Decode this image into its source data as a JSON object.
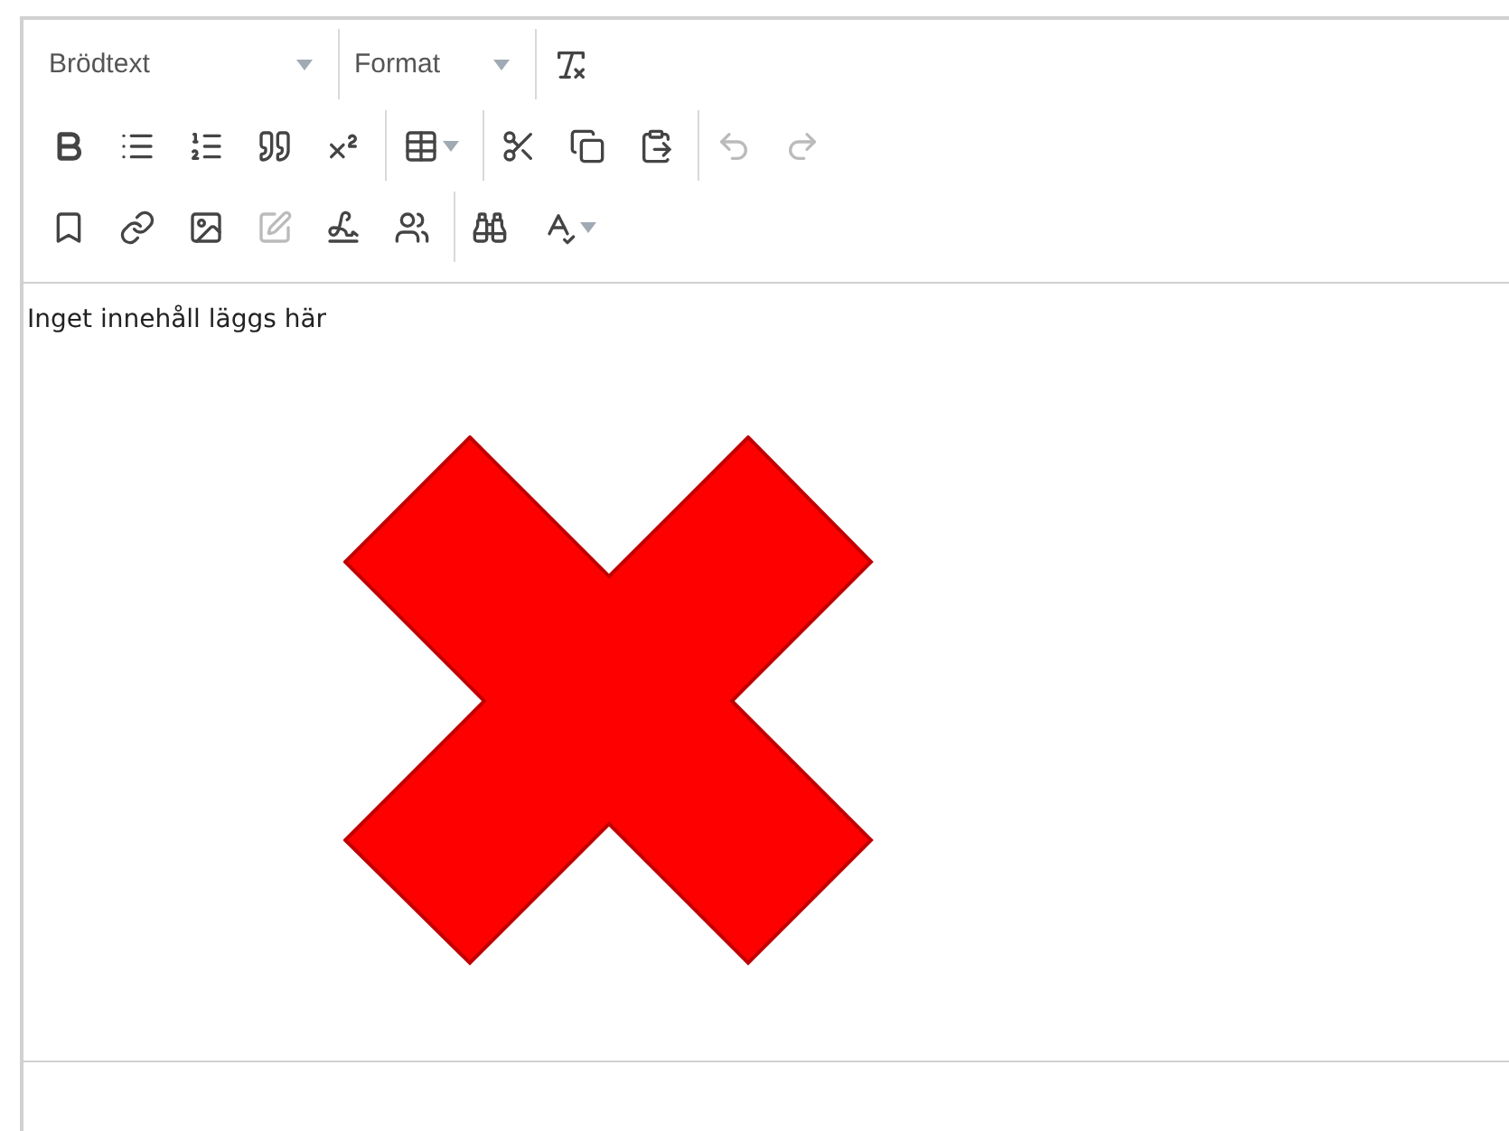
{
  "toolbar": {
    "rows": [
      {
        "groups": [
          {
            "kind": "style_select",
            "label": "Brödtext"
          },
          {
            "kind": "format_select",
            "label": "Format"
          },
          {
            "kind": "buttons",
            "buttons": [
              {
                "disabled": false
              }
            ]
          }
        ]
      },
      {
        "groups": [
          {
            "kind": "buttons",
            "buttons": [
              {
                "disabled": false
              },
              {
                "disabled": false
              },
              {
                "disabled": false
              },
              {
                "disabled": false
              },
              {
                "disabled": false
              }
            ]
          },
          {
            "kind": "buttons",
            "buttons": [
              {
                "disabled": false,
                "caret": true
              }
            ]
          },
          {
            "kind": "buttons",
            "buttons": [
              {
                "disabled": false
              },
              {
                "disabled": false
              },
              {
                "disabled": false
              }
            ]
          },
          {
            "kind": "buttons",
            "buttons": [
              {
                "disabled": true
              },
              {
                "disabled": true
              }
            ]
          }
        ]
      },
      {
        "groups": [
          {
            "kind": "buttons",
            "buttons": [
              {
                "disabled": false
              },
              {
                "disabled": false
              },
              {
                "disabled": false
              },
              {
                "disabled": true
              },
              {
                "disabled": false
              },
              {
                "disabled": false
              }
            ]
          },
          {
            "kind": "buttons",
            "buttons": [
              {
                "disabled": false
              },
              {
                "disabled": false,
                "caret": true
              }
            ]
          }
        ]
      }
    ]
  },
  "content": {
    "text": "Inget innehåll läggs här"
  }
}
